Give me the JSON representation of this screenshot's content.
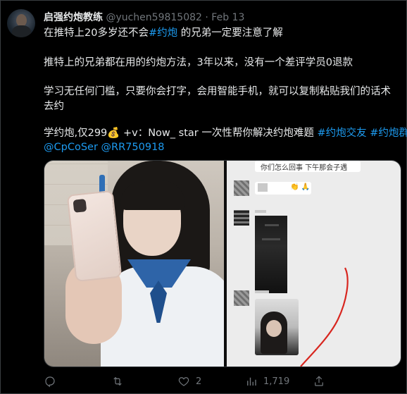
{
  "tweet": {
    "author_name": "启强约炮教练",
    "handle": "@yuchen59815082",
    "dot": "·",
    "date": "Feb 13",
    "line1_pre": "在推特上20多岁还不会",
    "line1_tag": "#约炮",
    "line1_post": " 的兄弟一定要注意了解",
    "line2": "推特上的兄弟都在用的约炮方法，3年以来，没有一个差评学员0退款",
    "line3a": "学习无任何门槛，只要你会打字，会用智能手机，就可以复制粘贴我们的话术",
    "line3b": "去约",
    "line4_pre": "学约炮,仅299",
    "line4_emoji": "💰",
    "line4_mid": " +v：Now_ star 一次性帮你解决约炮难题 ",
    "line4_tag1": "#约炮交友",
    "line4_space": " ",
    "line4_tag2": "#约炮群",
    "line5_mention1": "@CpCoSer",
    "line5_space": " ",
    "line5_mention2": "@RR750918"
  },
  "media_right_text": {
    "top": "你们怎么回事 下午那会子遇",
    "reaction": "👏 🙏"
  },
  "actions": {
    "reply_count": "",
    "retweet_count": "",
    "like_count": "2",
    "views_count": "1,719"
  },
  "icons": [
    "reply-icon",
    "retweet-icon",
    "like-icon",
    "views-icon",
    "share-icon"
  ]
}
